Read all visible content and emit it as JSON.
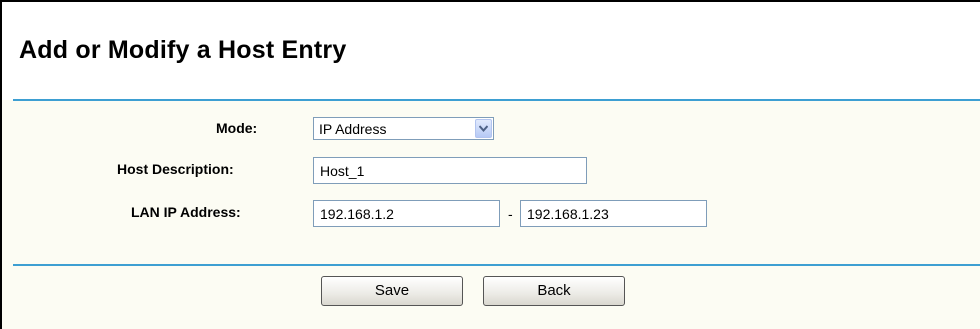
{
  "page": {
    "title": "Add or Modify a Host Entry"
  },
  "form": {
    "mode": {
      "label": "Mode:",
      "value": "IP Address"
    },
    "host_description": {
      "label": "Host Description:",
      "value": "Host_1"
    },
    "lan_ip": {
      "label": "LAN IP Address:",
      "start": "192.168.1.2",
      "separator": "-",
      "end": "192.168.1.23"
    }
  },
  "buttons": {
    "save": "Save",
    "back": "Back"
  },
  "colors": {
    "rule": "#3d9fd2",
    "panel_bg": "#fcfcf3"
  }
}
